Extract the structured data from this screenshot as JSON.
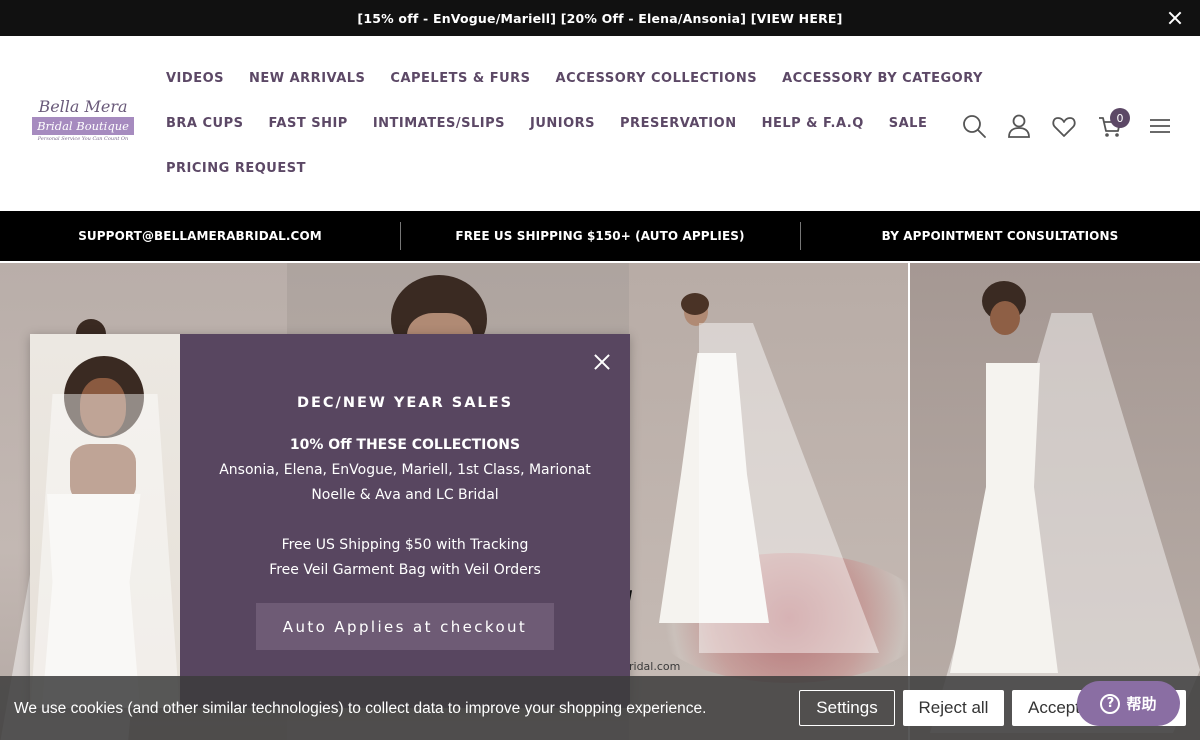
{
  "announcement": {
    "text": "[15% off - EnVogue/Mariell] [20% Off - Elena/Ansonia]  [VIEW HERE]"
  },
  "logo": {
    "script": "Bella Mera",
    "boxed": "Bridal Boutique",
    "tagline": "Personal Service You Can Count On"
  },
  "nav": {
    "row1": [
      "VIDEOS",
      "NEW ARRIVALS",
      "CAPELETS & FURS",
      "ACCESSORY COLLECTIONS",
      "ACCESSORY BY CATEGORY"
    ],
    "row2": [
      "BRA CUPS",
      "FAST SHIP",
      "INTIMATES/SLIPS",
      "JUNIORS",
      "PRESERVATION",
      "HELP & F.A.Q",
      "SALE"
    ],
    "row3": [
      "PRICING REQUEST"
    ]
  },
  "header_icons": [
    "search-icon",
    "account-icon",
    "wishlist-heart-icon",
    "cart-icon",
    "menu-icon"
  ],
  "cart": {
    "count": "0"
  },
  "info_strip": [
    "SUPPORT@BELLAMERABRIDAL.COM",
    "FREE US SHIPPING $150+ (AUTO APPLIES)",
    "BY APPOINTMENT CONSULTATIONS"
  ],
  "hero": {
    "url_text": "ridal.com"
  },
  "popup": {
    "title": "DEC/NEW YEAR SALES",
    "subtitle": "10% Off THESE COLLECTIONS",
    "line1": "Ansonia, Elena, EnVogue, Mariell, 1st Class, Marionat",
    "line2": "Noelle & Ava and LC Bridal",
    "line3": "Free US Shipping $50 with Tracking",
    "line4": "Free Veil Garment Bag with Veil Orders",
    "button": "Auto Applies at checkout"
  },
  "cookie": {
    "text": "We use cookies (and other similar technologies) to collect data to improve your shopping experience.",
    "settings": "Settings",
    "reject": "Reject all",
    "accept": "Accept"
  },
  "help": {
    "label": "帮助"
  },
  "colors": {
    "brand_purple": "#5c4866",
    "popup_bg": "#584660",
    "help_pill": "#8a6ea3"
  }
}
